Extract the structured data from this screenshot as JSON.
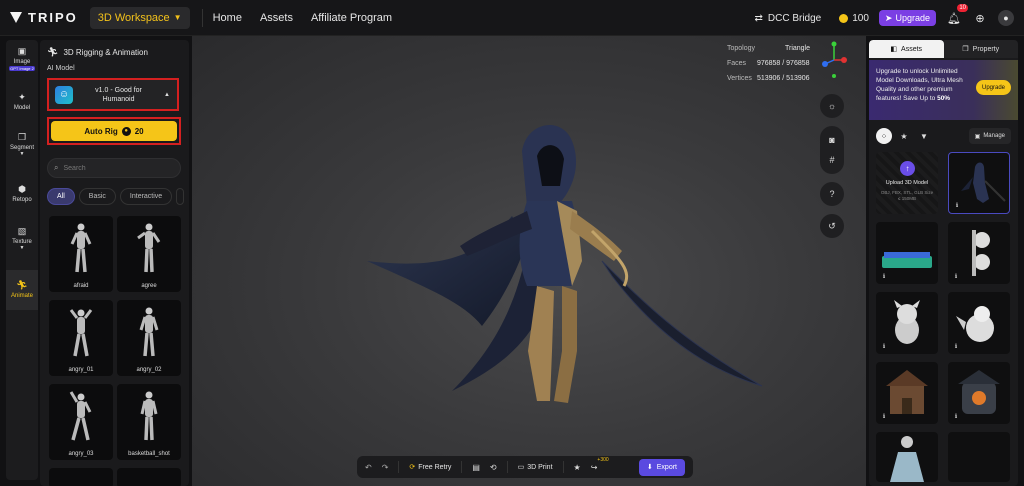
{
  "topbar": {
    "logo_text": "TRIPO",
    "workspace_label": "3D Workspace",
    "nav": [
      "Home",
      "Assets",
      "Affiliate Program"
    ],
    "dcc_label": "DCC Bridge",
    "credits": "100",
    "upgrade_label": "Upgrade",
    "notification_count": "10"
  },
  "rail": {
    "items": [
      {
        "label": "Image",
        "sub": "GPT Image 2",
        "icon": "image-icon"
      },
      {
        "label": "Model",
        "icon": "sparkle-icon"
      },
      {
        "label": "Segment",
        "icon": "cube-icon"
      },
      {
        "label": "Retopo",
        "icon": "mesh-icon"
      },
      {
        "label": "Texture",
        "icon": "texture-icon"
      },
      {
        "label": "Animate",
        "icon": "figure-icon"
      }
    ]
  },
  "panel": {
    "title": "3D Rigging & Animation",
    "ai_model_label": "AI Model",
    "model_name_line1": "v1.0 - Good for",
    "model_name_line2": "Humanoid",
    "autorig_label": "Auto Rig",
    "autorig_cost": "20",
    "search_placeholder": "Search",
    "filters": [
      "All",
      "Basic",
      "Interactive"
    ],
    "animations": [
      "afraid",
      "agree",
      "angry_01",
      "angry_02",
      "angry_03",
      "basketball_shot"
    ]
  },
  "viewport": {
    "topology_label": "Topology",
    "topology_value": "Triangle",
    "faces_label": "Faces",
    "faces_value": "976858 / 976858",
    "vertices_label": "Vertices",
    "vertices_value": "513906 / 513906"
  },
  "bottombar": {
    "free_retry": "Free Retry",
    "print_3d": "3D Print",
    "plus_points": "+300",
    "export": "Export"
  },
  "rpanel": {
    "tab_assets": "Assets",
    "tab_property": "Property",
    "promo_text": "Upgrade to unlock Unlimited Model Downloads, Ultra Mesh Quality and other premium features! Save Up to",
    "promo_percent": "50%",
    "promo_button": "Upgrade",
    "manage_label": "Manage",
    "upload_title": "Upload 3D Model",
    "upload_sub": "OBJ, FBX, STL, GLB Size ≤ 150MB"
  },
  "colors": {
    "accent": "#f5c518",
    "export": "#5a4ae0",
    "highlight": "#d42020"
  }
}
